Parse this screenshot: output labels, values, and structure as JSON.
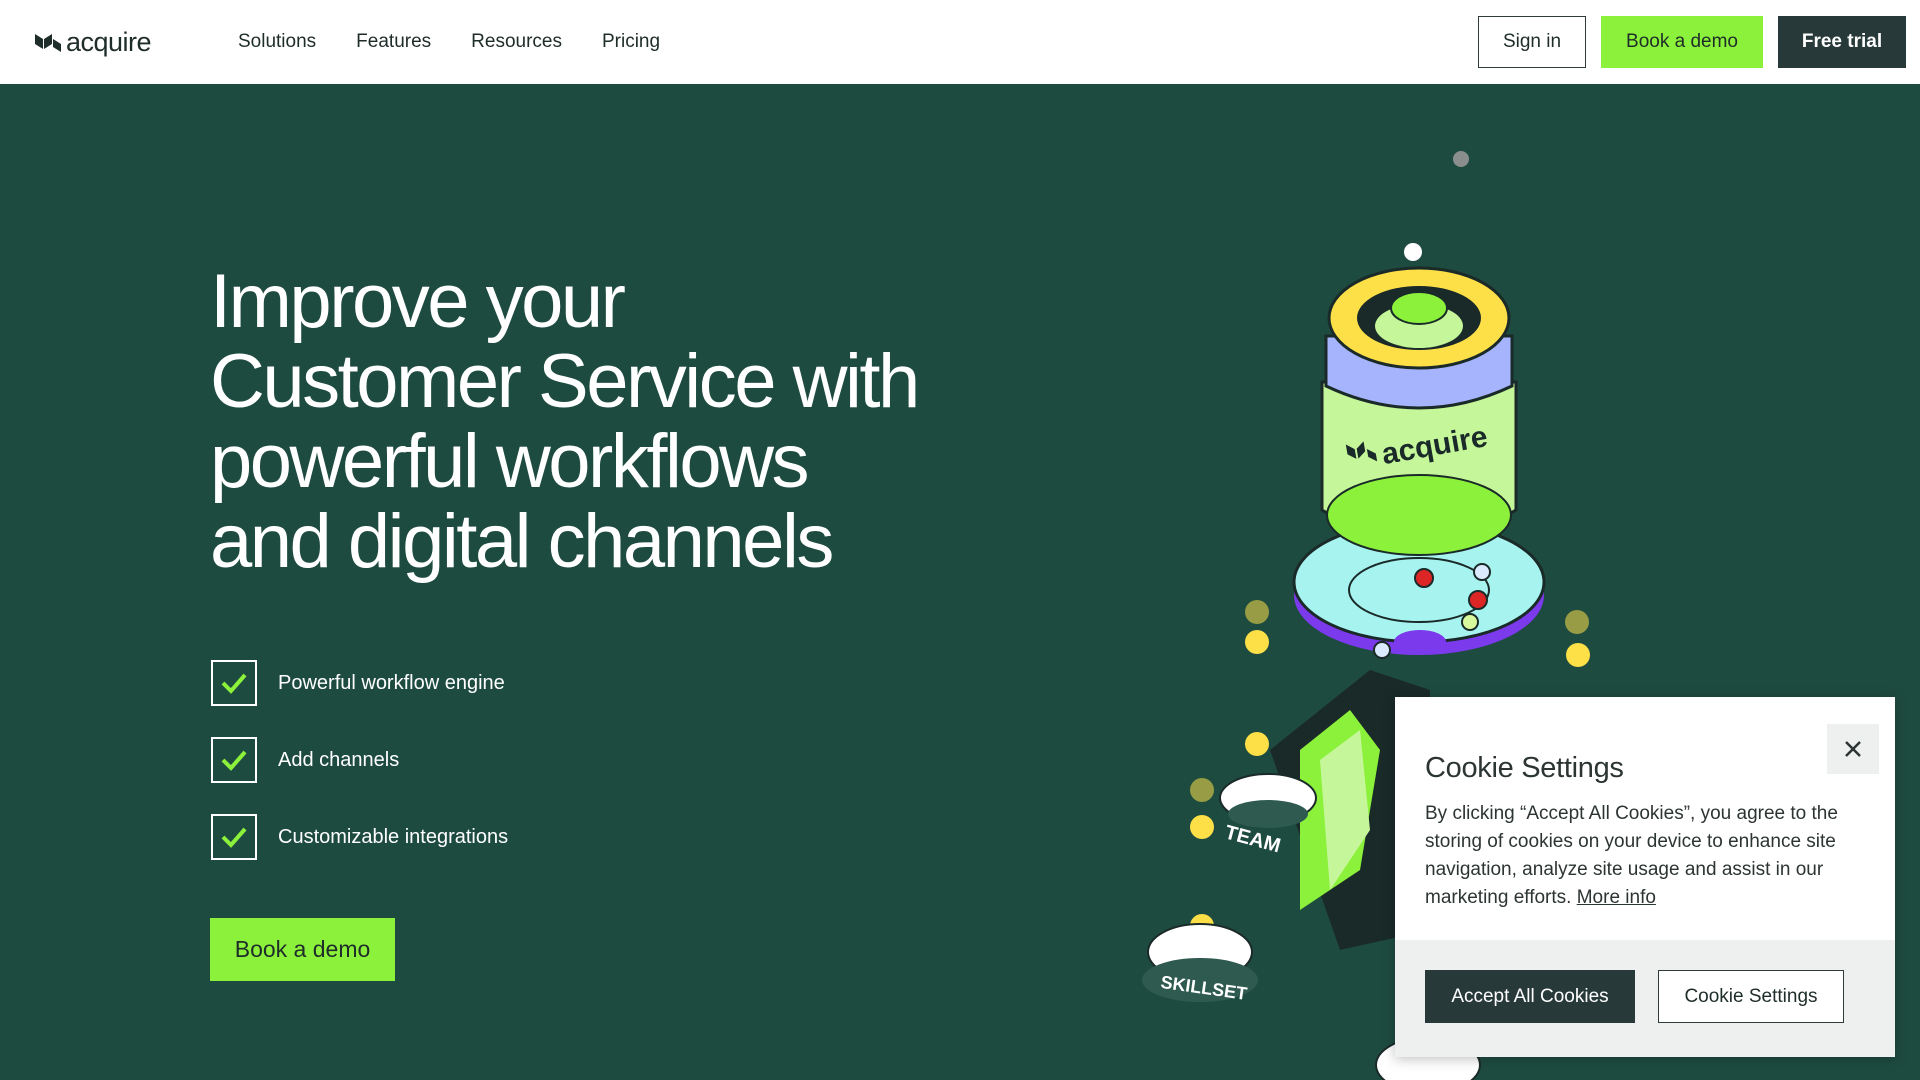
{
  "header": {
    "logo_text": "acquire",
    "nav": [
      {
        "label": "Solutions"
      },
      {
        "label": "Features"
      },
      {
        "label": "Resources"
      },
      {
        "label": "Pricing"
      }
    ],
    "sign_in": "Sign in",
    "book_demo": "Book a demo",
    "free_trial": "Free trial"
  },
  "hero": {
    "title_lines": [
      "Improve your",
      "Customer Service with",
      "powerful workflows",
      "and digital channels"
    ],
    "features": [
      {
        "label": "Powerful workflow engine"
      },
      {
        "label": "Add channels"
      },
      {
        "label": "Customizable integrations"
      }
    ],
    "cta": "Book a demo"
  },
  "illustration": {
    "can_label": "acquire",
    "tag_team": "TEAM",
    "tag_skillset": "SKILLSET"
  },
  "cookie": {
    "title": "Cookie Settings",
    "text": "By clicking “Accept All Cookies”, you agree to the storing of cookies on your device to enhance site navigation, analyze site usage and assist in our marketing efforts.",
    "more_info": "More info",
    "accept_all": "Accept All Cookies",
    "settings": "Cookie Settings"
  },
  "colors": {
    "bg_dark_green": "#1e4b40",
    "accent_green": "#8cf13b",
    "dark_button": "#28393a"
  }
}
